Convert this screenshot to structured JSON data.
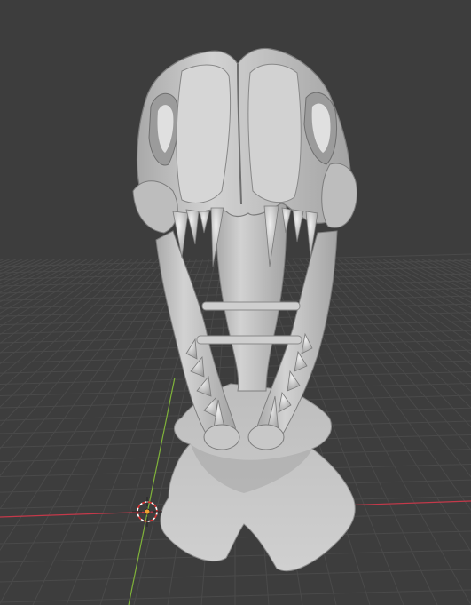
{
  "viewport": {
    "background_color": "#3d3d3d",
    "grid_color": "#4a4a4a",
    "x_axis_color": "#c4394a",
    "y_axis_color": "#7fb23a",
    "model_color": "#c6c6c6",
    "model_shadow_color": "#8f8f8f",
    "model_highlight_color": "#e2e2e2"
  },
  "objects": [
    {
      "name": "skull",
      "type": "mesh",
      "selected": false
    },
    {
      "name": "3d-cursor",
      "type": "cursor"
    }
  ]
}
